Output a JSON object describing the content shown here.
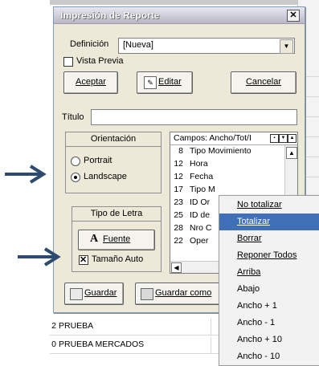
{
  "dialog": {
    "title": "Impresión de Reporte",
    "close_glyph": "✕",
    "definicion_label": "Definición",
    "definicion_value": "[Nueva]",
    "vista_previa_label": "Vista Previa",
    "aceptar_label": "Aceptar",
    "editar_label": "Editar",
    "cancelar_label": "Cancelar",
    "titulo_label": "Título",
    "titulo_value": "",
    "orientacion": {
      "title": "Orientación",
      "options": [
        "Portrait",
        "Landscape"
      ],
      "selected": "Landscape"
    },
    "tipo_letra": {
      "title": "Tipo de Letra",
      "fuente_label": "Fuente",
      "fuente_glyph": "A",
      "tamano_auto_label": "Tamaño Auto",
      "tamano_auto_checked": true
    },
    "campos": {
      "header": "Campos: Ancho/Tot/I",
      "items": [
        {
          "n": "8",
          "t": "Tipo Movimiento"
        },
        {
          "n": "12",
          "t": "Hora"
        },
        {
          "n": "12",
          "t": "Fecha"
        },
        {
          "n": "17",
          "t": "Tipo M"
        },
        {
          "n": "23",
          "t": "ID Or"
        },
        {
          "n": "25",
          "t": "ID de"
        },
        {
          "n": "28",
          "t": "Nro C"
        },
        {
          "n": "22",
          "t": "Oper"
        }
      ]
    },
    "guardar_label": "Guardar",
    "guardar_como_label": "Guardar como"
  },
  "context_menu": {
    "items": [
      "No totalizar",
      "Totalizar",
      "Borrar",
      "Reponer Todos",
      "Arriba",
      "Abajo",
      "Ancho + 1",
      "Ancho - 1",
      "Ancho + 10",
      "Ancho - 10"
    ],
    "highlighted": "Totalizar"
  },
  "background_rows": [
    {
      "num": "2",
      "text": "PRUEBA"
    },
    {
      "num": "0",
      "text": "PRUEBA MERCADOS"
    }
  ],
  "colors": {
    "menu_highlight": "#3f6fb6",
    "arrow": "#2e4a6e",
    "dialog_face": "#ece9d8"
  }
}
